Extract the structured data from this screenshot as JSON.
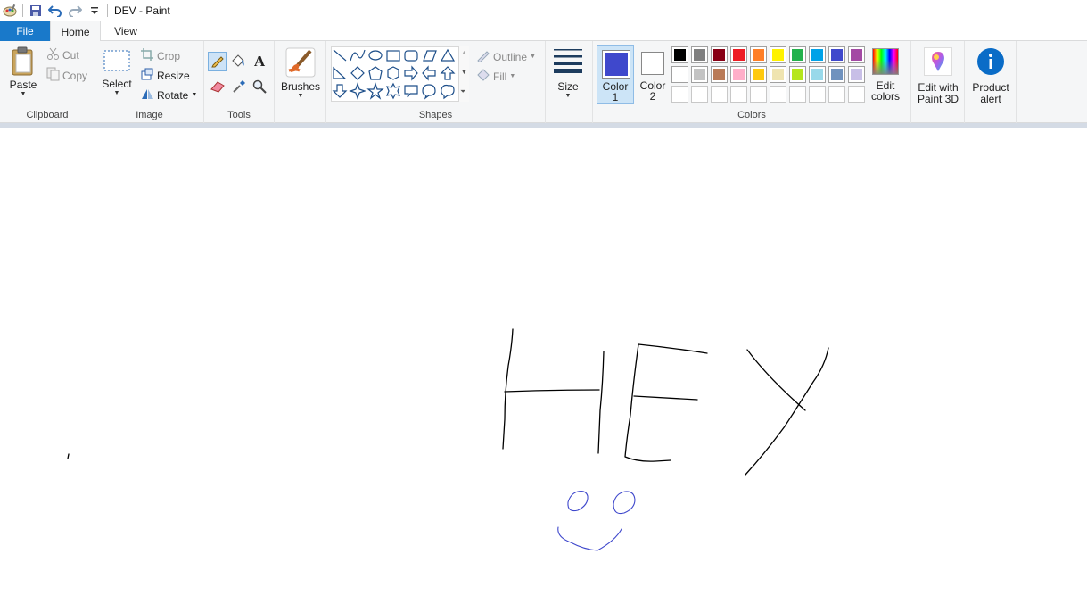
{
  "window": {
    "title": "DEV - Paint"
  },
  "tabs": {
    "file": "File",
    "home": "Home",
    "view": "View"
  },
  "clipboard": {
    "paste": "Paste",
    "cut": "Cut",
    "copy": "Copy",
    "group": "Clipboard"
  },
  "image": {
    "select": "Select",
    "crop": "Crop",
    "resize": "Resize",
    "rotate": "Rotate",
    "group": "Image"
  },
  "tools": {
    "group": "Tools"
  },
  "brushes": {
    "label": "Brushes"
  },
  "shapes": {
    "outline": "Outline",
    "fill": "Fill",
    "group": "Shapes"
  },
  "size": {
    "label": "Size"
  },
  "colors": {
    "color1_line1": "Color",
    "color1_line2": "1",
    "color2_line1": "Color",
    "color2_line2": "2",
    "edit_line1": "Edit",
    "edit_line2": "colors",
    "group": "Colors",
    "color1_value": "#3f48cc",
    "color2_value": "#ffffff",
    "palette_row1": [
      "#000000",
      "#7f7f7f",
      "#880015",
      "#ed1c24",
      "#ff7f27",
      "#fff200",
      "#22b14c",
      "#00a2e8",
      "#3f48cc",
      "#a349a4"
    ],
    "palette_row2": [
      "#ffffff",
      "#c3c3c3",
      "#b97a57",
      "#ffaec9",
      "#ffc90e",
      "#efe4b0",
      "#b5e61d",
      "#99d9ea",
      "#7092be",
      "#c8bfe7"
    ]
  },
  "paint3d": {
    "line1": "Edit with",
    "line2": "Paint 3D"
  },
  "product_alert": {
    "line1": "Product",
    "line2": "alert"
  },
  "drawing": {
    "ink_black": "#000000",
    "ink_blue": "#3f48cc"
  }
}
